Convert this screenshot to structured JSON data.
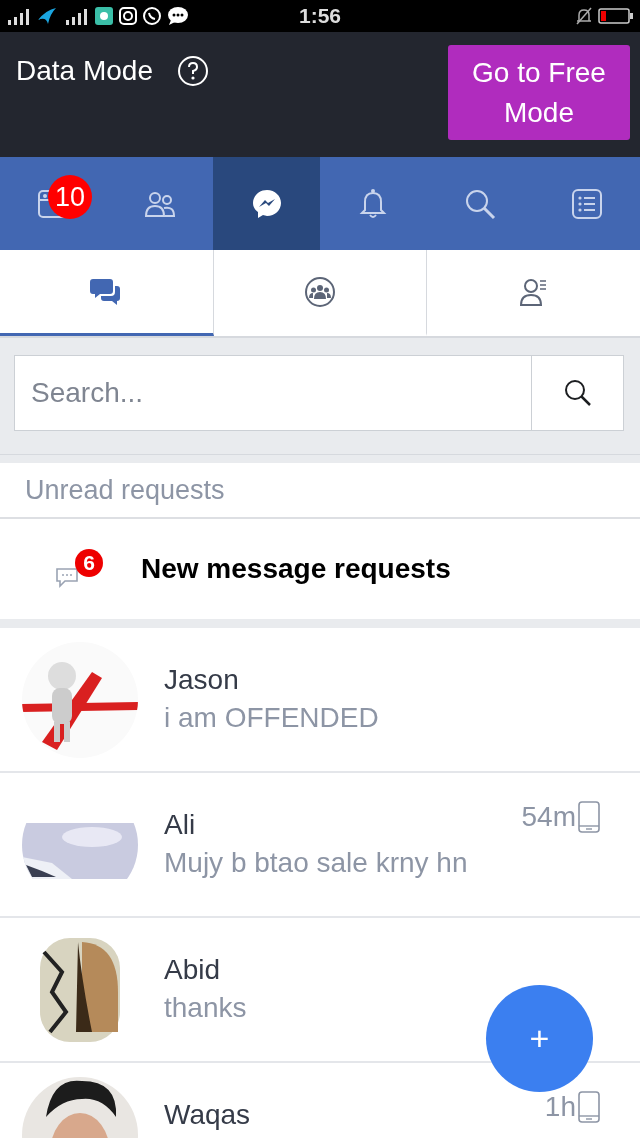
{
  "status_bar": {
    "time": "1:56"
  },
  "header": {
    "title": "Data Mode",
    "button": "Go to Free Mode"
  },
  "nav_tabs": [
    {
      "kind": "feed",
      "selected": false,
      "badge": "10"
    },
    {
      "kind": "friends",
      "selected": false
    },
    {
      "kind": "messenger",
      "selected": true
    },
    {
      "kind": "notifications",
      "selected": false
    },
    {
      "kind": "search",
      "selected": false
    },
    {
      "kind": "menu",
      "selected": false
    }
  ],
  "sub_tabs": [
    {
      "kind": "chats",
      "selected": true
    },
    {
      "kind": "groups",
      "selected": false
    },
    {
      "kind": "contacts",
      "selected": false
    }
  ],
  "search": {
    "placeholder": "Search..."
  },
  "section_label": "Unread requests",
  "requests": {
    "label": "New message requests",
    "badge": "6"
  },
  "conversations": [
    {
      "name": "Jason",
      "preview": "i am OFFENDED"
    },
    {
      "name": "Ali",
      "preview": "Mujy b btao sale krny hn",
      "time": "54m"
    },
    {
      "name": "Abid",
      "preview": "thanks"
    },
    {
      "name": "Waqas",
      "time": "1h"
    }
  ],
  "fab": {
    "label": "+"
  }
}
